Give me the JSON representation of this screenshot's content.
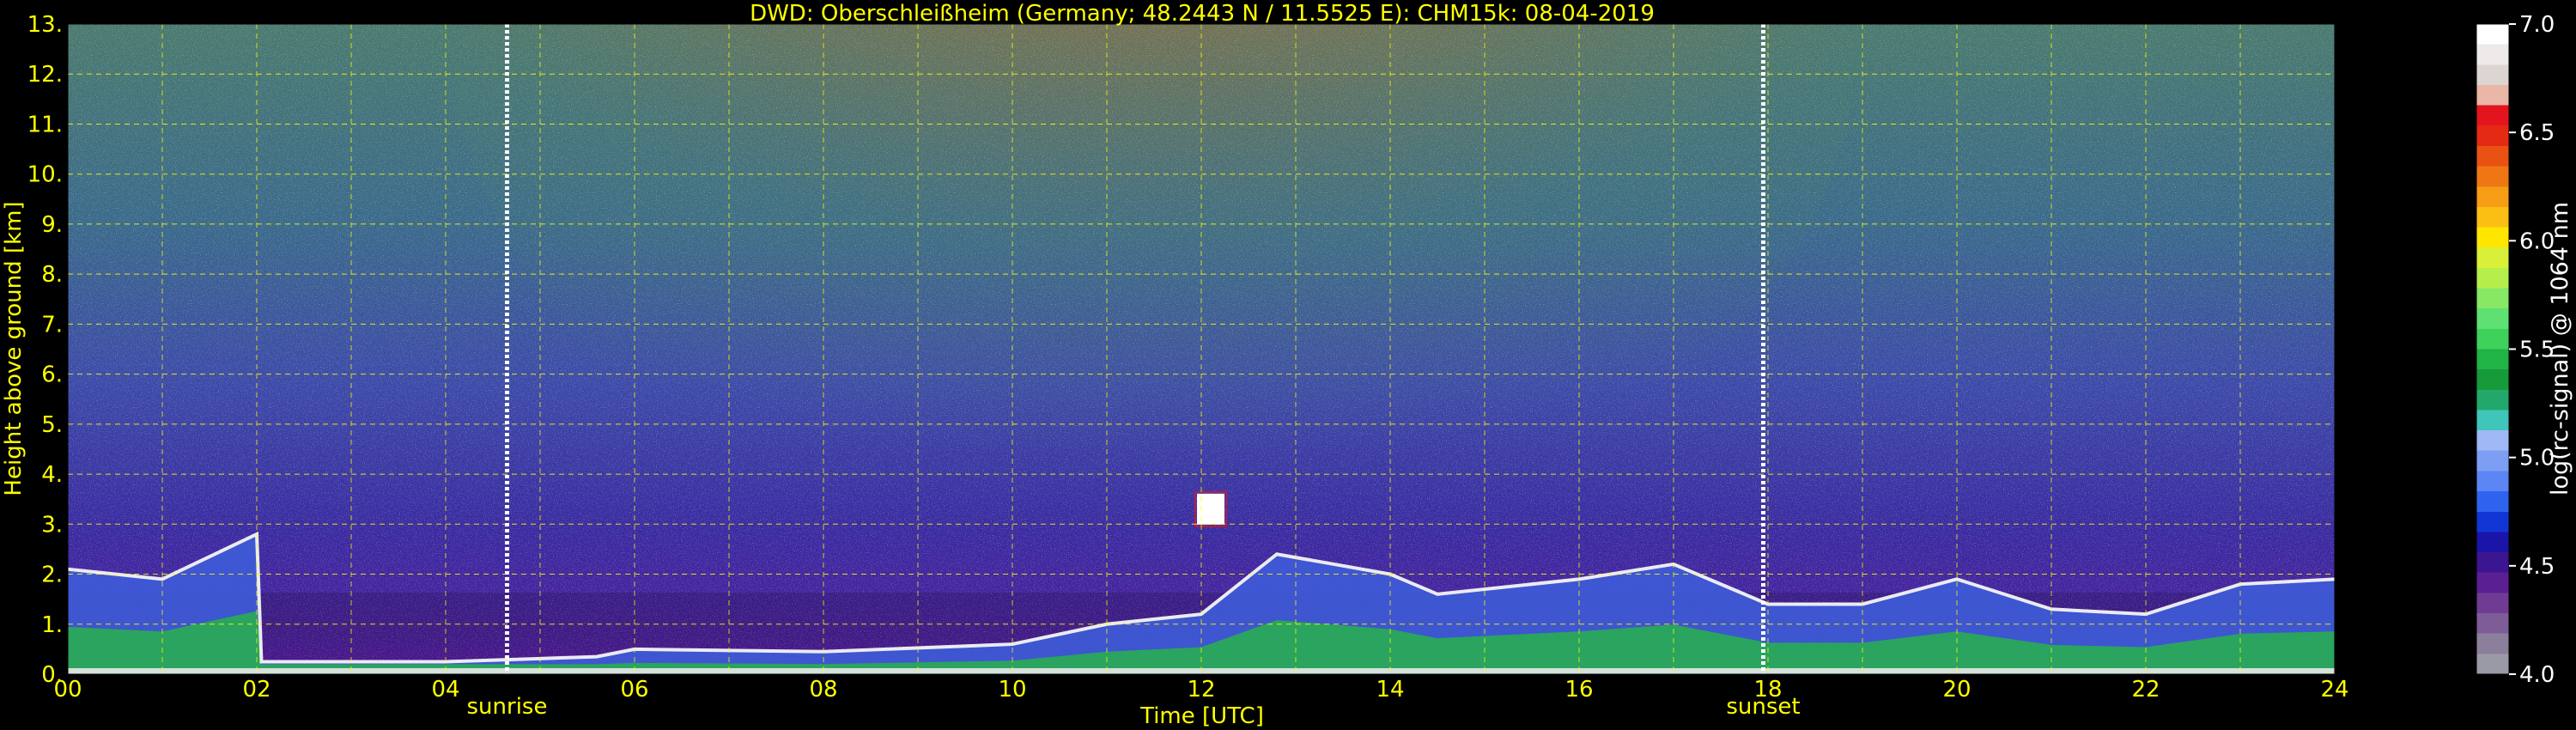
{
  "chart_data": {
    "type": "heatmap",
    "title": "DWD: Oberschleißheim (Germany; 48.2443 N / 11.5525 E):    CHM15k: 08-04-2019",
    "xlabel": "Time [UTC]",
    "ylabel": "Height above ground [km]",
    "xlim": [
      0,
      24
    ],
    "ylim": [
      0,
      13
    ],
    "x_ticks": [
      "00",
      "02",
      "04",
      "06",
      "08",
      "10",
      "12",
      "14",
      "16",
      "18",
      "20",
      "22",
      "24"
    ],
    "y_ticks": [
      "0.",
      "1.",
      "2.",
      "3.",
      "4.",
      "5.",
      "6.",
      "7.",
      "8.",
      "9.",
      "10.",
      "11.",
      "12.",
      "13."
    ],
    "grid": true,
    "events": [
      {
        "label": "sunrise",
        "time": 4.65
      },
      {
        "label": "sunset",
        "time": 17.95
      }
    ],
    "colorbar": {
      "label": "log(rc-signal) @ 1064 nm",
      "range": [
        4.0,
        7.0
      ],
      "ticks": [
        "4.0",
        "4.5",
        "5.0",
        "5.5",
        "6.0",
        "6.5",
        "7.0"
      ],
      "colors": [
        "#9a9aa6",
        "#8c7f9c",
        "#7e5c98",
        "#703b93",
        "#5a1f91",
        "#3c1590",
        "#1a14a8",
        "#1235d6",
        "#2e63ee",
        "#5c86f4",
        "#7d9ef4",
        "#9fb8f6",
        "#3fc5b9",
        "#23a86c",
        "#169a3a",
        "#20b345",
        "#3ed25b",
        "#5fe072",
        "#86e864",
        "#b6ee4c",
        "#d8f038",
        "#ffe600",
        "#fbbf14",
        "#f79c15",
        "#ef7713",
        "#e95212",
        "#e52a14",
        "#e3141e",
        "#eab6a8",
        "#dcd5d2",
        "#eeeaea",
        "#ffffff"
      ]
    },
    "boundary_layer_km": [
      [
        0.0,
        2.1
      ],
      [
        1.0,
        1.9
      ],
      [
        2.0,
        2.8
      ],
      [
        2.05,
        0.25
      ],
      [
        4.0,
        0.25
      ],
      [
        5.6,
        0.35
      ],
      [
        6.0,
        0.5
      ],
      [
        8.0,
        0.45
      ],
      [
        10.0,
        0.6
      ],
      [
        11.0,
        1.0
      ],
      [
        12.0,
        1.2
      ],
      [
        12.8,
        2.4
      ],
      [
        14.0,
        2.0
      ],
      [
        14.5,
        1.6
      ],
      [
        16.0,
        1.9
      ],
      [
        17.0,
        2.2
      ],
      [
        18.0,
        1.4
      ],
      [
        19.0,
        1.4
      ],
      [
        20.0,
        1.9
      ],
      [
        21.0,
        1.3
      ],
      [
        22.0,
        1.2
      ],
      [
        23.0,
        1.8
      ],
      [
        24.0,
        1.9
      ]
    ],
    "features": [
      {
        "type": "cloud",
        "time": 12.1,
        "height_km": 3.3
      }
    ]
  }
}
